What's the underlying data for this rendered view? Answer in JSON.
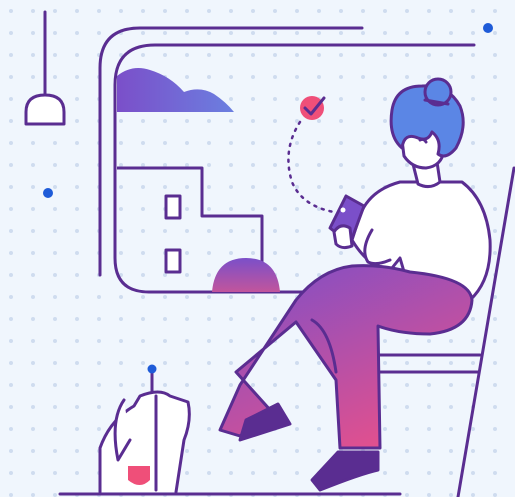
{
  "illustration": {
    "subject": "woman-sitting-by-window-with-phone",
    "icons": [
      "pendant-lamp-icon",
      "checkmark-badge-icon",
      "phone-icon",
      "dog-icon",
      "window-icon",
      "cloud-icon",
      "building-icon"
    ]
  },
  "colors": {
    "background": "#f0f6fd",
    "outline": "#5a2d91",
    "dot_grid": "#cfdcef",
    "accent_blue": "#1e5bd8",
    "hair": "#5b86e5",
    "gradient_purple": "#7b4fc9",
    "gradient_pink": "#e0508f",
    "check_badge": "#ef4f79",
    "dog_tongue": "#ef4f79",
    "skin": "#ffffff"
  }
}
